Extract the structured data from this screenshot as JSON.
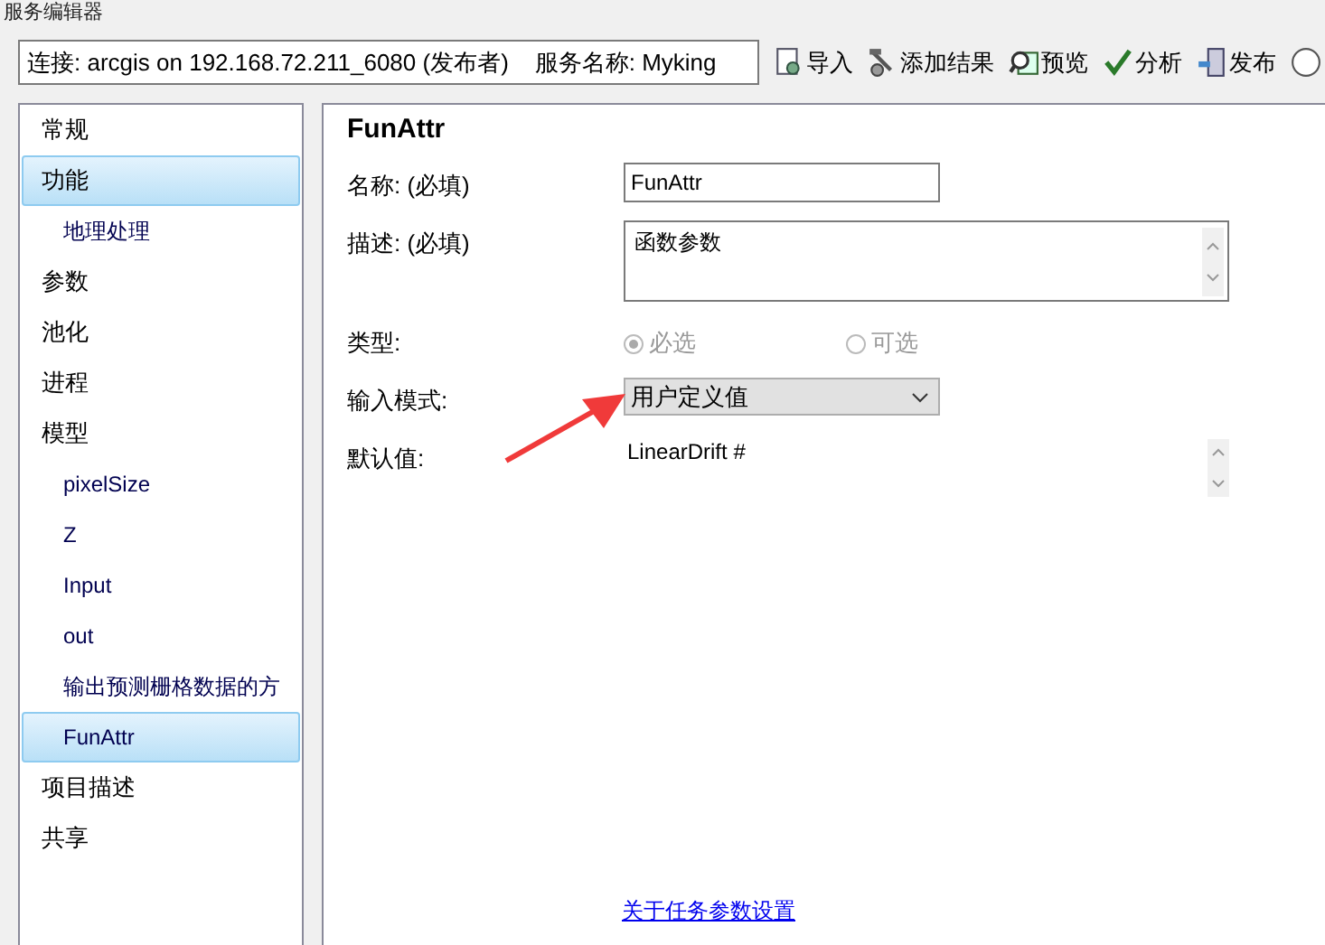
{
  "window": {
    "title": "服务编辑器"
  },
  "connection": {
    "value": "连接: arcgis on 192.168.72.211_6080 (发布者)    服务名称: Myking"
  },
  "toolbar": [
    {
      "label": "导入",
      "kind": "import"
    },
    {
      "label": "添加结果",
      "kind": "add"
    },
    {
      "label": "预览",
      "kind": "preview"
    },
    {
      "label": "分析",
      "kind": "analyze"
    },
    {
      "label": "发布",
      "kind": "publish"
    },
    {
      "kind": "more"
    }
  ],
  "sidebar": {
    "items": [
      {
        "label": "常规",
        "selected": false
      },
      {
        "label": "功能",
        "selected": true,
        "children": [
          {
            "label": "地理处理",
            "selected": false
          }
        ]
      },
      {
        "label": "参数",
        "selected": false
      },
      {
        "label": "池化",
        "selected": false
      },
      {
        "label": "进程",
        "selected": false
      },
      {
        "label": "模型",
        "selected": false,
        "children": [
          {
            "label": "pixelSize",
            "selected": false
          },
          {
            "label": "Z",
            "selected": false
          },
          {
            "label": "Input",
            "selected": false
          },
          {
            "label": "out",
            "selected": false
          },
          {
            "label": "输出预测栅格数据的方",
            "selected": false
          },
          {
            "label": "FunAttr",
            "selected": true
          }
        ]
      },
      {
        "label": "项目描述",
        "selected": false
      },
      {
        "label": "共享",
        "selected": false
      }
    ]
  },
  "panel": {
    "heading": "FunAttr",
    "fields": [
      {
        "kind": "text",
        "label": "名称: (必填)",
        "value": "FunAttr"
      },
      {
        "kind": "textarea",
        "label": "描述: (必填)",
        "value": "函数参数"
      },
      {
        "kind": "radio",
        "label": "类型:",
        "options": [
          {
            "label": "必选",
            "selected": true
          },
          {
            "label": "可选",
            "selected": false
          }
        ],
        "disabled": true
      },
      {
        "kind": "dropdown",
        "label": "输入模式:",
        "value": "用户定义值"
      },
      {
        "kind": "readonly",
        "label": "默认值:",
        "value": "LinearDrift #"
      }
    ],
    "link": "关于任务参数设置"
  }
}
